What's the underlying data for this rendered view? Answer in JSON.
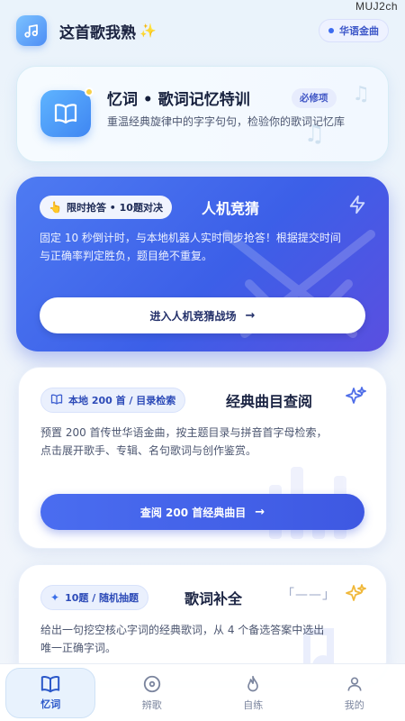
{
  "watermark": "MUJ2ch",
  "header": {
    "title": "这首歌我熟",
    "badge": "华语金曲"
  },
  "card1": {
    "title": "忆词 • 歌词记忆特训",
    "tag": "必修项",
    "desc": "重温经典旋律中的字字句句，检验你的歌词记忆库"
  },
  "card2": {
    "pill": "限时抢答 • 10题对决",
    "title": "人机竞猜",
    "desc": "固定 10 秒倒计时，与本地机器人实时同步抢答！根据提交时间与正确率判定胜负，题目绝不重复。",
    "button": "进入人机竞猜战场"
  },
  "card3": {
    "pill": "本地 200 首 / 目录检索",
    "title": "经典曲目查阅",
    "desc": "预置 200 首传世华语金曲，按主题目录与拼音首字母检索，点击展开歌手、专辑、名句歌词与创作鉴赏。",
    "button": "查阅 200 首经典曲目"
  },
  "card4": {
    "pill": "10题 / 随机抽题",
    "title": "歌词补全",
    "blank": "「——」",
    "desc": "给出一句挖空核心字词的经典歌词，从 4 个备选答案中选出唯一正确字词。"
  },
  "nav": [
    {
      "label": "忆词",
      "icon": "book-icon",
      "active": true
    },
    {
      "label": "辨歌",
      "icon": "disc-icon",
      "active": false
    },
    {
      "label": "自练",
      "icon": "flame-icon",
      "active": false
    },
    {
      "label": "我的",
      "icon": "person-icon",
      "active": false
    }
  ],
  "colors": {
    "accent": "#3f5fe6",
    "card2_bg": "#4a6cf0",
    "tag_bg": "#e7ecfd"
  }
}
